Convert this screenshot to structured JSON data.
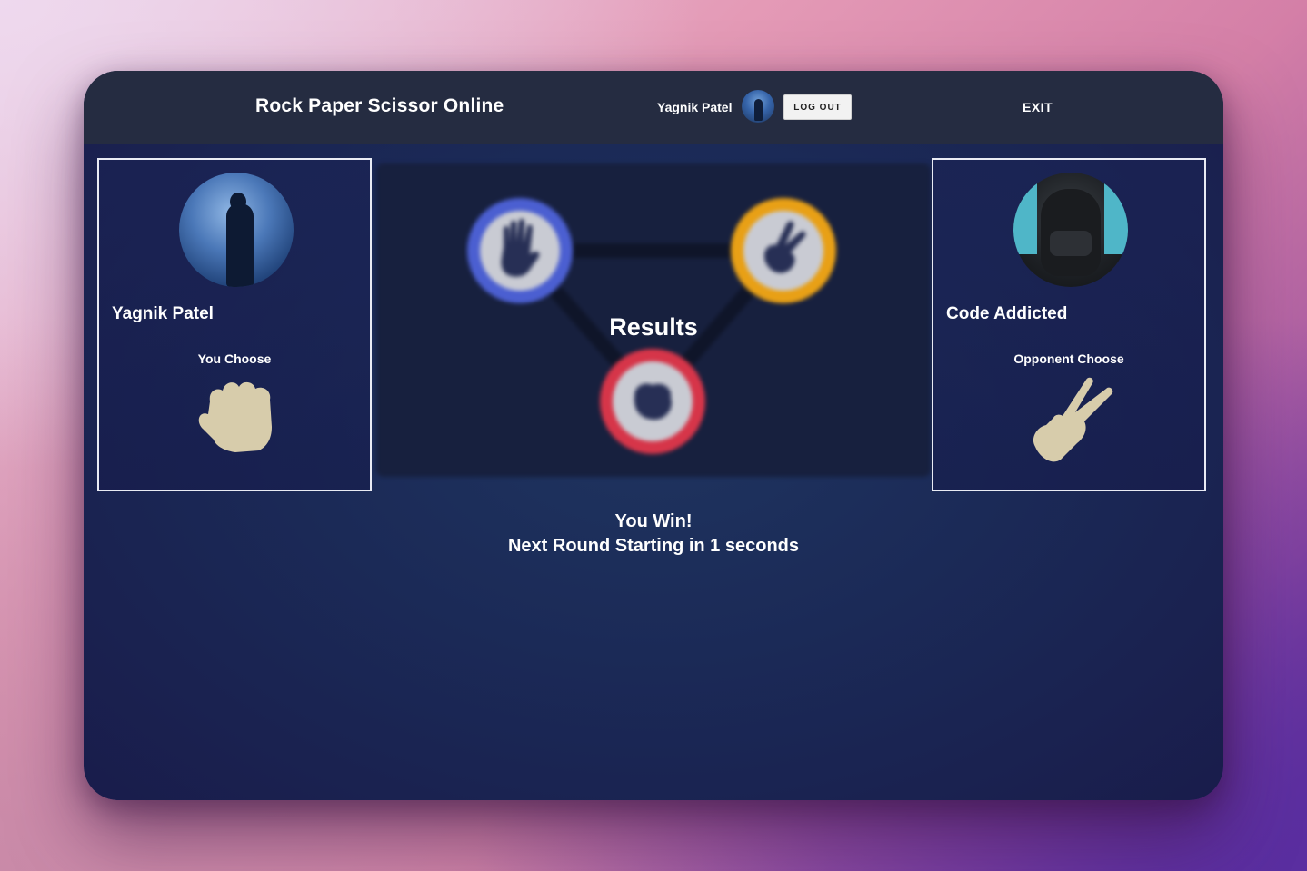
{
  "header": {
    "title": "Rock Paper Scissor Online",
    "user_name": "Yagnik Patel",
    "logout_label": "LOG OUT",
    "exit_label": "EXIT"
  },
  "players": {
    "you": {
      "name": "Yagnik Patel",
      "choose_label": "You Choose",
      "choice": "rock"
    },
    "opponent": {
      "name": "Code Addicted",
      "choose_label": "Opponent Choose",
      "choice": "scissor"
    }
  },
  "board": {
    "results_label": "Results",
    "options": [
      {
        "name": "paper",
        "ring_color": "#4b5fd1"
      },
      {
        "name": "scissor",
        "ring_color": "#e8a016"
      },
      {
        "name": "rock",
        "ring_color": "#d63549"
      }
    ]
  },
  "outcome": {
    "result": "You Win!",
    "next_round": "Next Round Starting in 1 seconds"
  },
  "colors": {
    "hand": "#d7ccab",
    "topbar": "#252c41",
    "card_border": "#e9ebf4"
  }
}
